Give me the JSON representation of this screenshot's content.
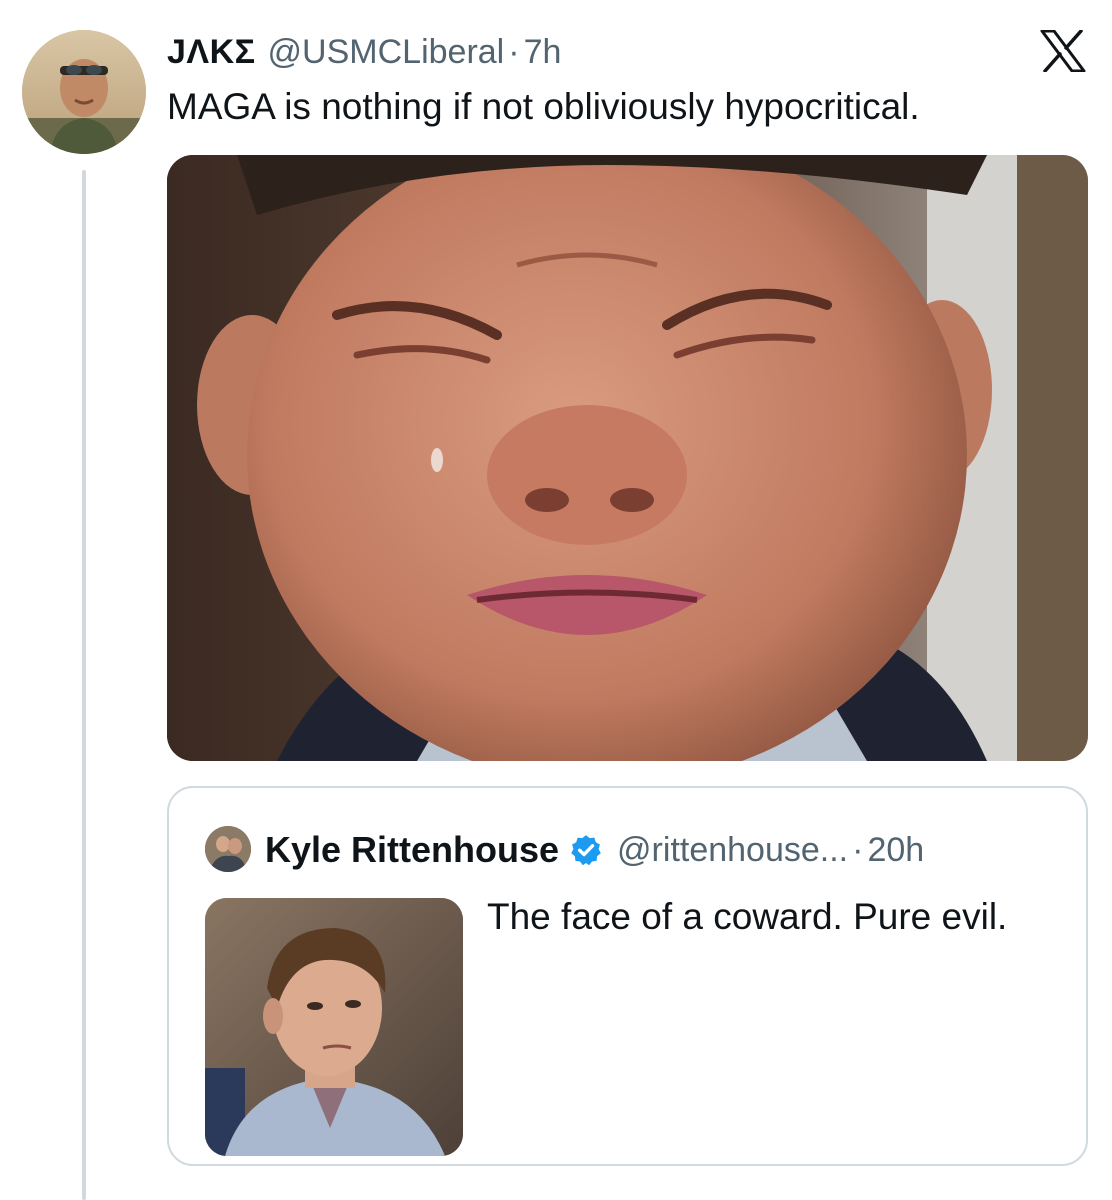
{
  "author": {
    "display_name": "JΛΚΣ",
    "handle": "@USMCLiberal",
    "separator": "·",
    "time": "7h",
    "text": "MAGA is nothing if not obliviously hypocritical."
  },
  "platform_icon": "x-logo-icon",
  "quoted_tweet": {
    "display_name": "Kyle Rittenhouse",
    "verified_icon": "verified-badge-icon",
    "handle": "@rittenhouse...",
    "separator": "·",
    "time": "20h",
    "text": "The face of a coward. Pure evil."
  },
  "colors": {
    "text": "#0f1419",
    "secondary_text": "#536471",
    "border": "#cfd9de",
    "verified": "#1d9bf0"
  }
}
